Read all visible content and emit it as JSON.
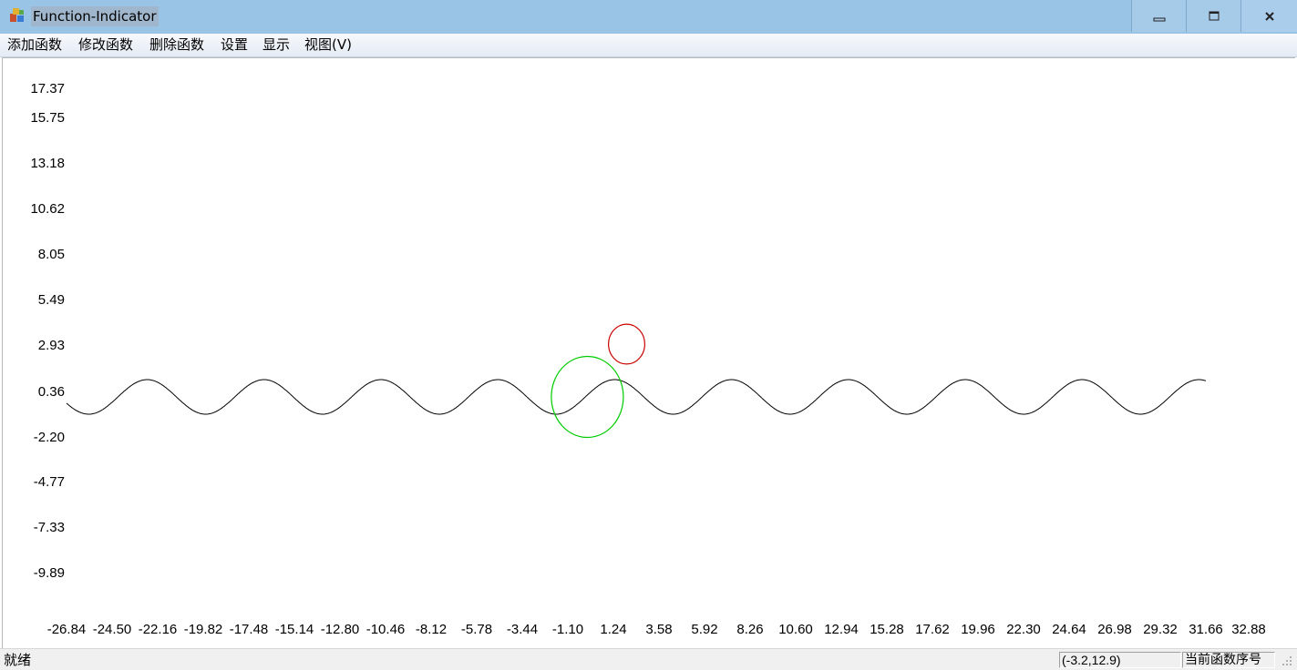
{
  "window": {
    "title": "Function-Indicator",
    "icon": "app-blocks-icon",
    "controls": {
      "minimize_icon": "minimize-icon",
      "maximize_icon": "restore-icon",
      "close_icon": "close-icon"
    }
  },
  "menu": {
    "items": [
      "添加函数",
      "修改函数",
      "删除函数",
      "设置",
      "显示",
      "视图(V)"
    ]
  },
  "chart_data": {
    "type": "line",
    "title": "",
    "xlabel": "",
    "ylabel": "",
    "grid": false,
    "y_tick_labels": [
      "17.37",
      "15.75",
      "13.18",
      "10.62",
      "8.05",
      "5.49",
      "2.93",
      "0.36",
      "-2.20",
      "-4.77",
      "-7.33",
      "-9.89"
    ],
    "x_tick_labels": [
      "-26.84",
      "-24.50",
      "-22.16",
      "-19.82",
      "-17.48",
      "-15.14",
      "-12.80",
      "-10.46",
      "-8.12",
      "-5.78",
      "-3.44",
      "-1.10",
      "1.24",
      "3.58",
      "5.92",
      "8.26",
      "10.60",
      "12.94",
      "15.28",
      "17.62",
      "19.96",
      "22.30",
      "24.64",
      "26.98",
      "29.32",
      "31.66",
      "32.88"
    ],
    "xlim": [
      -26.84,
      32.88
    ],
    "ylim": [
      -9.89,
      17.37
    ],
    "series": [
      {
        "color": "#000000",
        "kind": "sine",
        "description_x_range": [
          -26.84,
          31.66
        ],
        "amplitude": 1.0,
        "period": 6.0,
        "phase_x_of_peak": 1.3,
        "center_y": 0.36
      }
    ],
    "circles": [
      {
        "color": "#00cc00",
        "center": [
          -0.1,
          0.36
        ],
        "radius_x": 1.85,
        "radius_y": 1.97
      },
      {
        "color": "#cc0000",
        "center": [
          1.92,
          2.93
        ],
        "radius_x": 0.93,
        "radius_y": 0.97
      }
    ]
  },
  "status": {
    "ready": "就绪",
    "coordinates": "(-3.2,12.9)",
    "function_index_label": "当前函数序号"
  }
}
